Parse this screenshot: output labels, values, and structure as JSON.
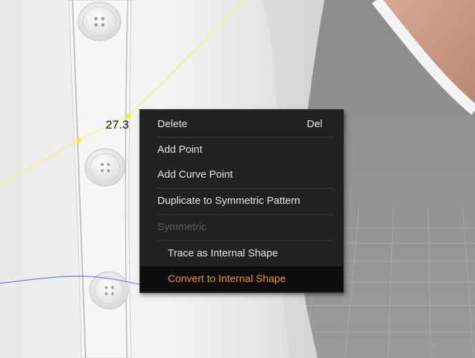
{
  "viewport": {
    "measurement_label": "27.3 ",
    "colors": {
      "guide_line": "#f5f56a",
      "pattern_line": "#5a5ad0",
      "shirt": "#f0f0f0",
      "skin": "#c99a86"
    }
  },
  "context_menu": {
    "items": [
      {
        "label": "Delete",
        "shortcut": "Del",
        "state": "normal"
      },
      {
        "label": "Add Point",
        "state": "normal"
      },
      {
        "label": "Add Curve Point",
        "state": "normal"
      },
      {
        "label": "Duplicate to Symmetric Pattern",
        "state": "normal"
      },
      {
        "label": "Symmetric",
        "state": "disabled"
      },
      {
        "label": "Trace as Internal Shape",
        "state": "submenu-item"
      },
      {
        "label": "Convert to Internal Shape",
        "state": "highlighted"
      }
    ],
    "colors": {
      "background": "#222225",
      "text": "#e6e6e6",
      "disabled_text": "#5c5c5e",
      "highlight_text": "#e8922f"
    }
  }
}
